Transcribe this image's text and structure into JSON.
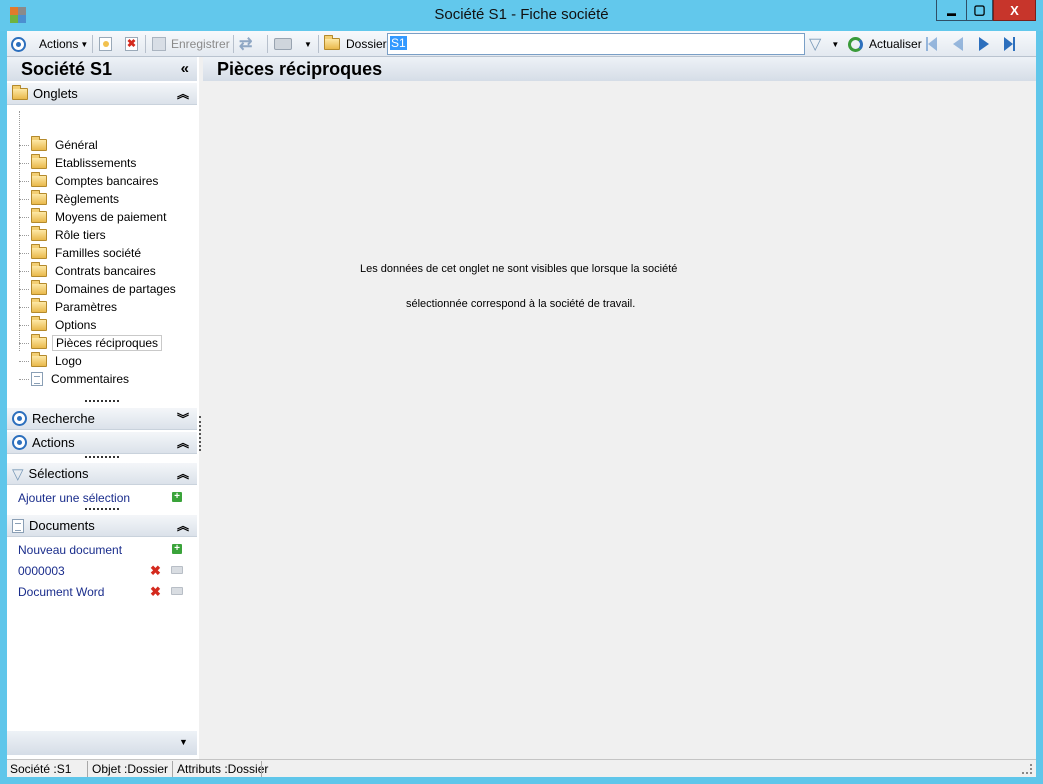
{
  "window": {
    "title": "Société S1 -  Fiche société",
    "minimize_label": "▬",
    "maximize_label": "▢",
    "close_label": "X"
  },
  "toolbar": {
    "actions_label": "Actions",
    "save_label": "Enregistrer",
    "dossier_label": "Dossier",
    "dossier_value": "S1",
    "refresh_label": "Actualiser"
  },
  "sidebar": {
    "title": "Société S1",
    "onglets_header": "Onglets",
    "items": [
      {
        "label": "Général"
      },
      {
        "label": "Etablissements"
      },
      {
        "label": "Comptes bancaires"
      },
      {
        "label": "Règlements"
      },
      {
        "label": "Moyens de paiement"
      },
      {
        "label": "Rôle tiers"
      },
      {
        "label": "Familles société"
      },
      {
        "label": "Contrats bancaires"
      },
      {
        "label": "Domaines de partages"
      },
      {
        "label": "Paramètres"
      },
      {
        "label": "Options"
      },
      {
        "label": "Pièces réciproques"
      },
      {
        "label": "Logo"
      },
      {
        "label": "Commentaires"
      }
    ],
    "selected_index": 11,
    "recherche_header": "Recherche",
    "actions_header": "Actions",
    "selections_header": "Sélections",
    "add_selection_link": "Ajouter une sélection",
    "documents_header": "Documents",
    "new_document_link": "Nouveau document",
    "documents": [
      {
        "label": "0000003"
      },
      {
        "label": "Document Word"
      }
    ]
  },
  "main": {
    "title": "Pièces réciproques",
    "message_line1": "Les données de cet onglet ne sont visibles que lorsque la société",
    "message_line2": "sélectionnée correspond à la société de travail."
  },
  "status": {
    "societe": "Société :S1",
    "objet": "Objet :Dossier",
    "attributs": "Attributs :Dossier"
  },
  "colors": {
    "titlebar": "#62c8ec",
    "accent_blue": "#2c6fbd",
    "close_red": "#c7352b",
    "link": "#1a2d8c"
  }
}
